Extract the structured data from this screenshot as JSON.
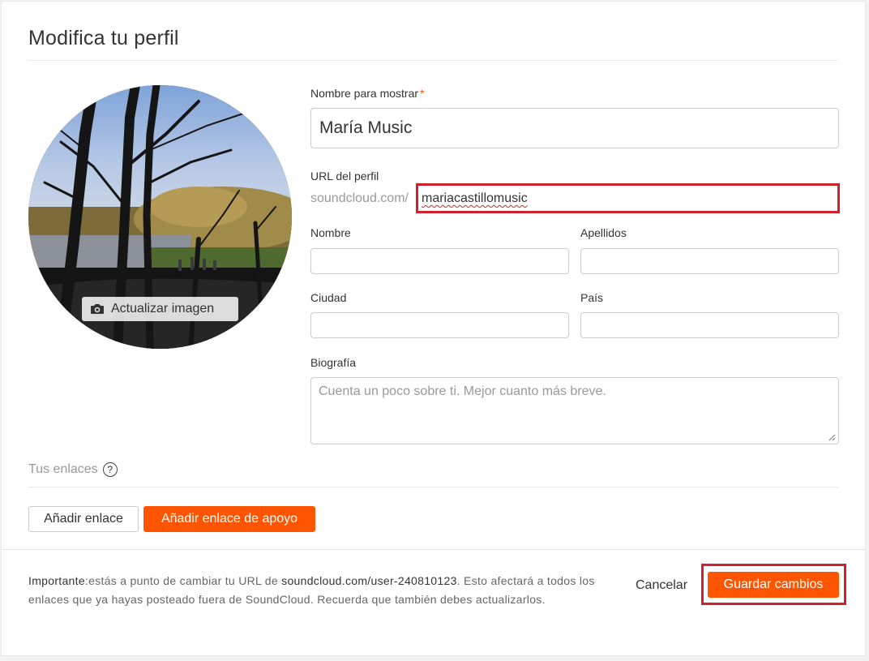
{
  "title": "Modifica tu perfil",
  "avatar": {
    "update_label": "Actualizar imagen",
    "icon": "camera-icon"
  },
  "form": {
    "display_name": {
      "label": "Nombre para mostrar",
      "required_mark": "*",
      "value": "María Music"
    },
    "profile_url": {
      "label": "URL del perfil",
      "prefix": "soundcloud.com/",
      "value": "mariacastillomusic"
    },
    "first_name": {
      "label": "Nombre",
      "value": ""
    },
    "last_name": {
      "label": "Apellidos",
      "value": ""
    },
    "city": {
      "label": "Ciudad",
      "value": ""
    },
    "country": {
      "label": "País",
      "value": ""
    },
    "bio": {
      "label": "Biografía",
      "placeholder": "Cuenta un poco sobre ti. Mejor cuanto más breve.",
      "value": ""
    }
  },
  "links": {
    "label": "Tus enlaces",
    "help": "?",
    "add_link_label": "Añadir enlace",
    "add_support_link_label": "Añadir enlace de apoyo"
  },
  "footer": {
    "important_label": "Importante",
    "warning_part1": ":estás a punto de cambiar tu URL de ",
    "warning_url": "soundcloud.com/user-240810123",
    "warning_part2": ". Esto afectará a todos los enlaces que ya hayas posteado fuera de SoundCloud. Recuerda que también debes actualizarlos.",
    "cancel_label": "Cancelar",
    "save_label": "Guardar cambios"
  },
  "colors": {
    "accent": "#ff5500",
    "highlight": "#d0202a"
  }
}
